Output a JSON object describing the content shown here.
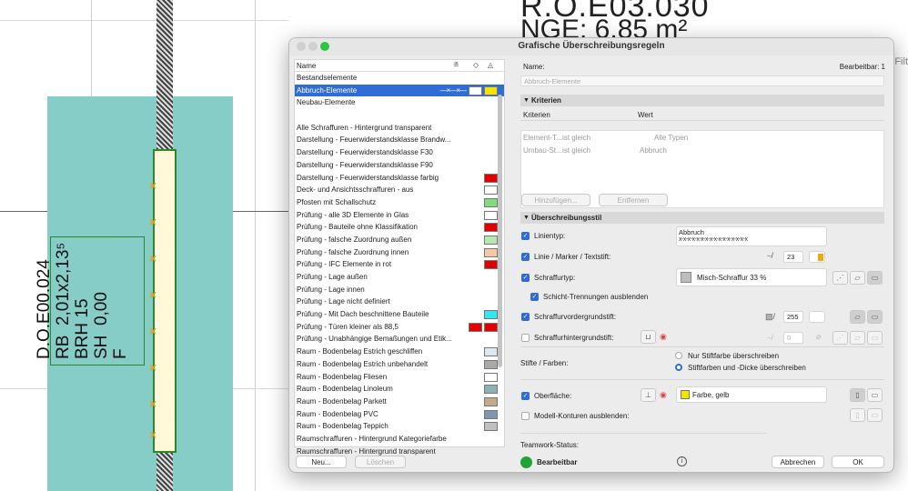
{
  "dialog": {
    "title": "Grafische Überschreibungsregeln"
  },
  "list": {
    "header_name": "Name",
    "header_icons": [
      "line-pen-icon",
      "fill-icon",
      "surface-icon"
    ],
    "groups": [
      "Bestandselemente",
      "Abbruch-Elemente",
      "Neubau-Elemente"
    ],
    "selected": "Abbruch-Elemente",
    "selected_line_sample": "—×—×—",
    "items": [
      {
        "label": "Alle Schraffuren - Hintergrund transparent",
        "swatch": ""
      },
      {
        "label": "Darstellung - Feuerwiderstandsklasse Brandw...",
        "swatch": ""
      },
      {
        "label": "Darstellung - Feuerwiderstandsklasse F30",
        "swatch": ""
      },
      {
        "label": "Darstellung - Feuerwiderstandsklasse F90",
        "swatch": ""
      },
      {
        "label": "Darstellung - Feuerwiderstandsklasse farbig",
        "swatch": "#e00000"
      },
      {
        "label": "Deck- und Ansichtsschraffuren - aus",
        "swatch": "#ffffff"
      },
      {
        "label": "Pfosten mit Schallschutz",
        "swatch": "#7fdc7f"
      },
      {
        "label": "Prüfung - alle 3D Elemente in Glas",
        "swatch": "#ffffff"
      },
      {
        "label": "Prüfung - Bauteile ohne Klassifikation",
        "swatch": "#e00000"
      },
      {
        "label": "Prüfung - falsche Zuordnung außen",
        "swatch": "#b8e6b0"
      },
      {
        "label": "Prüfung - falsche Zuordnung innen",
        "swatch": "#f3c9a8"
      },
      {
        "label": "Prüfung - IFC Elemente in rot",
        "swatch": "#e00000"
      },
      {
        "label": "Prüfung - Lage außen",
        "swatch": ""
      },
      {
        "label": "Prüfung - Lage innen",
        "swatch": ""
      },
      {
        "label": "Prüfung - Lage nicht definiert",
        "swatch": ""
      },
      {
        "label": "Prüfung - Mit Dach beschnittene Bauteile",
        "swatch": "#33e6f0"
      },
      {
        "label": "Prüfung - Türen kleiner als 88,5",
        "swatch": "#e00000",
        "swatch2": "#e00000"
      },
      {
        "label": "Prüfung - Unabhängige Bemaßungen und Etik...",
        "swatch": ""
      },
      {
        "label": "Raum - Bodenbelag Estrich geschliffen",
        "swatch": "#dde8f5"
      },
      {
        "label": "Raum - Bodenbelag Estrich unbehandelt",
        "swatch": "#a9a9a9"
      },
      {
        "label": "Raum - Bodenbelag Fliesen",
        "swatch": "#ffffff"
      },
      {
        "label": "Raum - Bodenbelag Linoleum",
        "swatch": "#8fb0b4"
      },
      {
        "label": "Raum - Bodenbelag Parkett",
        "swatch": "#c4a98a"
      },
      {
        "label": "Raum - Bodenbelag PVC",
        "swatch": "#7d97b0"
      },
      {
        "label": "Raum - Bodenbelag Teppich",
        "swatch": "#c0c0c0"
      },
      {
        "label": "Raumschraffuren - Hintergrund Kategoriefarbe",
        "swatch": ""
      },
      {
        "label": "Raumschraffuren - Hintergrund transparent",
        "swatch": ""
      }
    ],
    "new_button": "Neu...",
    "delete_button": "Löschen"
  },
  "detail": {
    "name_label": "Name:",
    "name_placeholder": "Abbruch-Elemente",
    "editable_label": "Bearbeitbar: 1",
    "criteria_section": "Kriterien",
    "criteria_col1": "Kriterien",
    "criteria_col2": "Wert",
    "criteria_rows": [
      {
        "crit": "Element-T...",
        "op": "ist gleich",
        "val": "Alle Typen"
      },
      {
        "crit": "Umbau-St...",
        "op": "ist gleich",
        "val": "Abbruch"
      }
    ],
    "add_button": "Hinzufügen...",
    "remove_button": "Entfernen",
    "style_section": "Überschreibungsstil",
    "linetype_label": "Linientyp:",
    "linetype_value": "Abbruch",
    "linetype_sample": "x-x-x-x-x-x-x-x-x-x-x-x-x-x-x-x",
    "pen_label": "Linie / Marker / Textstift:",
    "pen_value": "23",
    "pen_color": "#f5a800",
    "hatch_label": "Schraffurtyp:",
    "hatch_value": "Misch-Schraffur 33 %",
    "hide_lines_label": "Schicht-Trennungen ausblenden",
    "fg_pen_label": "Schraffurvordergrundstift:",
    "fg_pen_value": "255",
    "bg_pen_label": "Schraffurhintergrundstift:",
    "bg_pen_value": "0",
    "pens_label": "Stifte / Farben:",
    "radio1": "Nur Stiftfarbe überschreiben",
    "radio2": "Stiftfarben und -Dicke überschreiben",
    "surface_label": "Oberfläche:",
    "surface_value": "Farbe, gelb",
    "surface_color": "#f5e400",
    "model_label": "Modell-Konturen ausblenden:",
    "teamwork_label": "Teamwork-Status:",
    "teamwork_value": "Bearbeitbar",
    "cancel_button": "Abbrechen",
    "ok_button": "OK"
  },
  "background": {
    "room_title": "R.O.E03.030",
    "room_area": "NGE: 6,85 m²",
    "door_stamp": "D.O.E00.024\nRB  2,01x2,13⁵\nBRH 15\nSH  0,00\nF",
    "right_edge_label": "-Filt"
  }
}
